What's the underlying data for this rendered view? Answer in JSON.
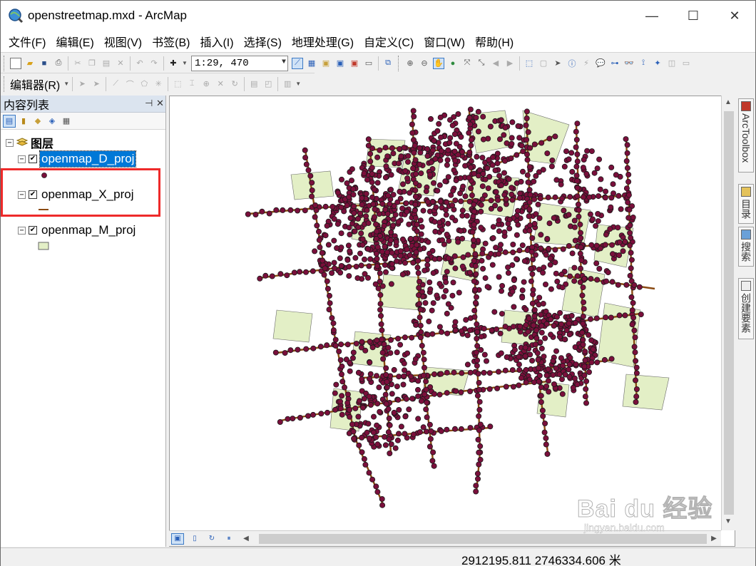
{
  "window": {
    "title": "openstreetmap.mxd - ArcMap",
    "controls": {
      "minimize": "—",
      "maximize": "☐",
      "close": "✕"
    }
  },
  "menu": [
    "文件(F)",
    "编辑(E)",
    "视图(V)",
    "书签(B)",
    "插入(I)",
    "选择(S)",
    "地理处理(G)",
    "自定义(C)",
    "窗口(W)",
    "帮助(H)"
  ],
  "toolbar": {
    "scale_value": "1:29, 470",
    "editor_label": "编辑器(R)"
  },
  "toc": {
    "title": "内容列表",
    "group_name": "图层",
    "layers": [
      {
        "name": "openmap_D_proj",
        "symbol": "point",
        "checked": true,
        "selected": true
      },
      {
        "name": "openmap_X_proj",
        "symbol": "line",
        "checked": true,
        "selected": false
      },
      {
        "name": "openmap_M_proj",
        "symbol": "polygon",
        "checked": true,
        "selected": false
      }
    ]
  },
  "dock": {
    "tabs": [
      "ArcToolbox",
      "目录",
      "搜索",
      "创建要素"
    ]
  },
  "status": {
    "coordinates": "2912195.811  2746334.606 米"
  },
  "watermark": {
    "brand": "Bai du 经验",
    "url": "jingyan.baidu.com"
  },
  "colors": {
    "point_fill": "#7a0f3b",
    "line_color": "#8a4a12",
    "polygon_fill": "#e3efc6",
    "selection": "#0078d7",
    "highlight": "#ee2a2a"
  }
}
